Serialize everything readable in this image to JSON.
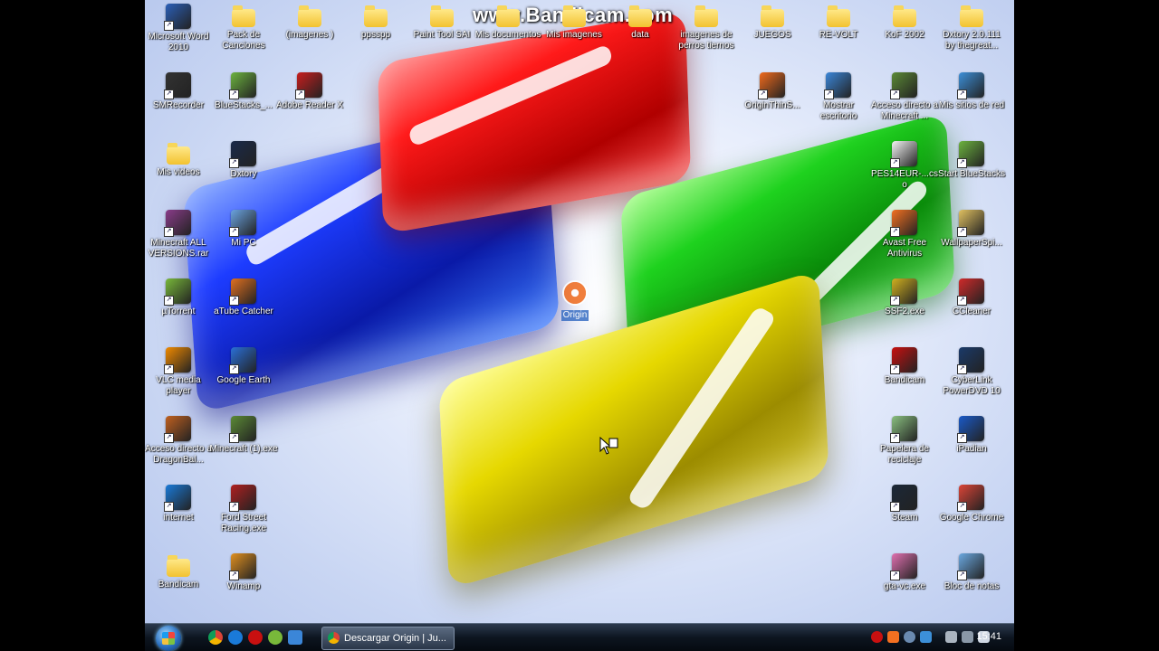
{
  "watermark": "www.Bandicam.com",
  "desktop_icons": [
    {
      "id": "ms-word",
      "label": "Microsoft Word 2010",
      "col": 0,
      "row": 0,
      "color": "#2b5fb8",
      "type": "app"
    },
    {
      "id": "pack-canciones",
      "label": "Pack de Canciones",
      "col": 1,
      "row": 0,
      "type": "folder"
    },
    {
      "id": "imagenes",
      "label": "(imagenes )",
      "col": 2,
      "row": 0,
      "type": "folder"
    },
    {
      "id": "ppsspp",
      "label": "ppsspp",
      "col": 3,
      "row": 0,
      "type": "folder"
    },
    {
      "id": "paint-tool-sai",
      "label": "Paint Tool SAI",
      "col": 4,
      "row": 0,
      "type": "folder"
    },
    {
      "id": "mis-documentos",
      "label": "Mis documentos",
      "col": 5,
      "row": 0,
      "type": "folder"
    },
    {
      "id": "mis-imagenes",
      "label": "Mis imagenes",
      "col": 6,
      "row": 0,
      "type": "folder"
    },
    {
      "id": "data",
      "label": "data",
      "col": 7,
      "row": 0,
      "type": "folder"
    },
    {
      "id": "imagenes-perros",
      "label": "imagenes de perros tiernos",
      "col": 8,
      "row": 0,
      "type": "folder"
    },
    {
      "id": "juegos",
      "label": "JUEGOS",
      "col": 9,
      "row": 0,
      "type": "folder"
    },
    {
      "id": "re-volt",
      "label": "RE-VOLT",
      "col": 10,
      "row": 0,
      "type": "folder"
    },
    {
      "id": "kof-2002",
      "label": "KoF 2002",
      "col": 11,
      "row": 0,
      "type": "folder"
    },
    {
      "id": "dxtory-folder",
      "label": "Dxtory 2.0.111 by thegreat...",
      "col": 12,
      "row": 0,
      "type": "folder"
    },
    {
      "id": "smrecorder",
      "label": "SMRecorder",
      "col": 0,
      "row": 1,
      "color": "#333",
      "type": "app"
    },
    {
      "id": "bluestacks",
      "label": "BlueStacks_...",
      "col": 1,
      "row": 1,
      "color": "#6cb33f",
      "type": "app"
    },
    {
      "id": "adobe-reader",
      "label": "Adobe Reader X",
      "col": 2,
      "row": 1,
      "color": "#c81e1e",
      "type": "app"
    },
    {
      "id": "originthins",
      "label": "OriginThinS...",
      "col": 9,
      "row": 1,
      "color": "#f06a1c",
      "type": "app"
    },
    {
      "id": "mostrar-escritorio",
      "label": "Mostrar escritorio",
      "col": 10,
      "row": 1,
      "color": "#3b86d8",
      "type": "app"
    },
    {
      "id": "acceso-minecraft",
      "label": "Acceso directo a Minecraft ...",
      "col": 11,
      "row": 1,
      "color": "#5b8a36",
      "type": "app"
    },
    {
      "id": "mis-sitios-red",
      "label": "Mis sitios de red",
      "col": 12,
      "row": 1,
      "color": "#3c8fd8",
      "type": "app"
    },
    {
      "id": "mis-videos",
      "label": "Mis videos",
      "col": 0,
      "row": 2,
      "type": "folder"
    },
    {
      "id": "dxtory",
      "label": "Dxtory",
      "col": 1,
      "row": 2,
      "color": "#1a2a4a",
      "type": "app"
    },
    {
      "id": "pes14",
      "label": "PES14EUR-...cso",
      "col": 11,
      "row": 2,
      "color": "#f4f4f4",
      "type": "app"
    },
    {
      "id": "start-bluestacks",
      "label": "Start BlueStacks",
      "col": 12,
      "row": 2,
      "color": "#6cb33f",
      "type": "app"
    },
    {
      "id": "minecraft-all",
      "label": "Minecraft ALL VERSIONS.rar",
      "col": 0,
      "row": 3,
      "color": "#8a3c8a",
      "type": "app"
    },
    {
      "id": "mi-pc",
      "label": "Mi PC",
      "col": 1,
      "row": 3,
      "color": "#6aa3e0",
      "type": "app"
    },
    {
      "id": "avast",
      "label": "Avast Free Antivirus",
      "col": 11,
      "row": 3,
      "color": "#f37021",
      "type": "app"
    },
    {
      "id": "wallpaperspi",
      "label": "WallpaperSpi...",
      "col": 12,
      "row": 3,
      "color": "#e0c060",
      "type": "app"
    },
    {
      "id": "utorrent",
      "label": "µTorrent",
      "col": 0,
      "row": 4,
      "color": "#78b83a",
      "type": "app"
    },
    {
      "id": "atube-catcher",
      "label": "aTube Catcher",
      "col": 1,
      "row": 4,
      "color": "#e07020",
      "type": "app"
    },
    {
      "id": "ssf2",
      "label": "SSF2.exe",
      "col": 11,
      "row": 4,
      "color": "#d0b020",
      "type": "app"
    },
    {
      "id": "ccleaner",
      "label": "CCleaner",
      "col": 12,
      "row": 4,
      "color": "#d02a2a",
      "type": "app"
    },
    {
      "id": "vlc",
      "label": "VLC media player",
      "col": 0,
      "row": 5,
      "color": "#f08a00",
      "type": "app"
    },
    {
      "id": "google-earth",
      "label": "Google Earth",
      "col": 1,
      "row": 5,
      "color": "#2a6fd8",
      "type": "app"
    },
    {
      "id": "bandicam-app",
      "label": "Bandicam",
      "col": 11,
      "row": 5,
      "color": "#c81010",
      "type": "app"
    },
    {
      "id": "powerdvd",
      "label": "CyberLink PowerDVD 10",
      "col": 12,
      "row": 5,
      "color": "#1a3a6a",
      "type": "app"
    },
    {
      "id": "acceso-dragonball",
      "label": "Acceso directo a DragonBal...",
      "col": 0,
      "row": 6,
      "color": "#c06020",
      "type": "app"
    },
    {
      "id": "minecraft-exe",
      "label": "Minecraft (1).exe",
      "col": 1,
      "row": 6,
      "color": "#5b8a36",
      "type": "app"
    },
    {
      "id": "papelera",
      "label": "Papelera de reciclaje",
      "col": 11,
      "row": 6,
      "color": "#8ac080",
      "type": "app"
    },
    {
      "id": "ipadian",
      "label": "iPadian",
      "col": 12,
      "row": 6,
      "color": "#1a5ac8",
      "type": "app"
    },
    {
      "id": "internet",
      "label": "internet",
      "col": 0,
      "row": 7,
      "color": "#1a7ad8",
      "type": "app"
    },
    {
      "id": "ford-street",
      "label": "Ford Street Racing.exe",
      "col": 1,
      "row": 7,
      "color": "#b02020",
      "type": "app"
    },
    {
      "id": "steam",
      "label": "Steam",
      "col": 11,
      "row": 7,
      "color": "#1b2838",
      "type": "app"
    },
    {
      "id": "google-chrome",
      "label": "Google Chrome",
      "col": 12,
      "row": 7,
      "color": "#db4437",
      "type": "app"
    },
    {
      "id": "bandicam-folder",
      "label": "Bandicam",
      "col": 0,
      "row": 8,
      "type": "folder"
    },
    {
      "id": "winamp",
      "label": "Winamp",
      "col": 1,
      "row": 8,
      "color": "#e09020",
      "type": "app"
    },
    {
      "id": "gta-vc",
      "label": "gta-vc.exe",
      "col": 11,
      "row": 8,
      "color": "#e070b0",
      "type": "app"
    },
    {
      "id": "bloc-notas",
      "label": "Bloc de notas",
      "col": 12,
      "row": 8,
      "color": "#6aa8e0",
      "type": "app"
    }
  ],
  "dragged_icon": {
    "label": "Origin",
    "color": "#f06a1c"
  },
  "taskbar": {
    "task_label": "Descargar Origin | Ju...",
    "clock": "15:41"
  }
}
